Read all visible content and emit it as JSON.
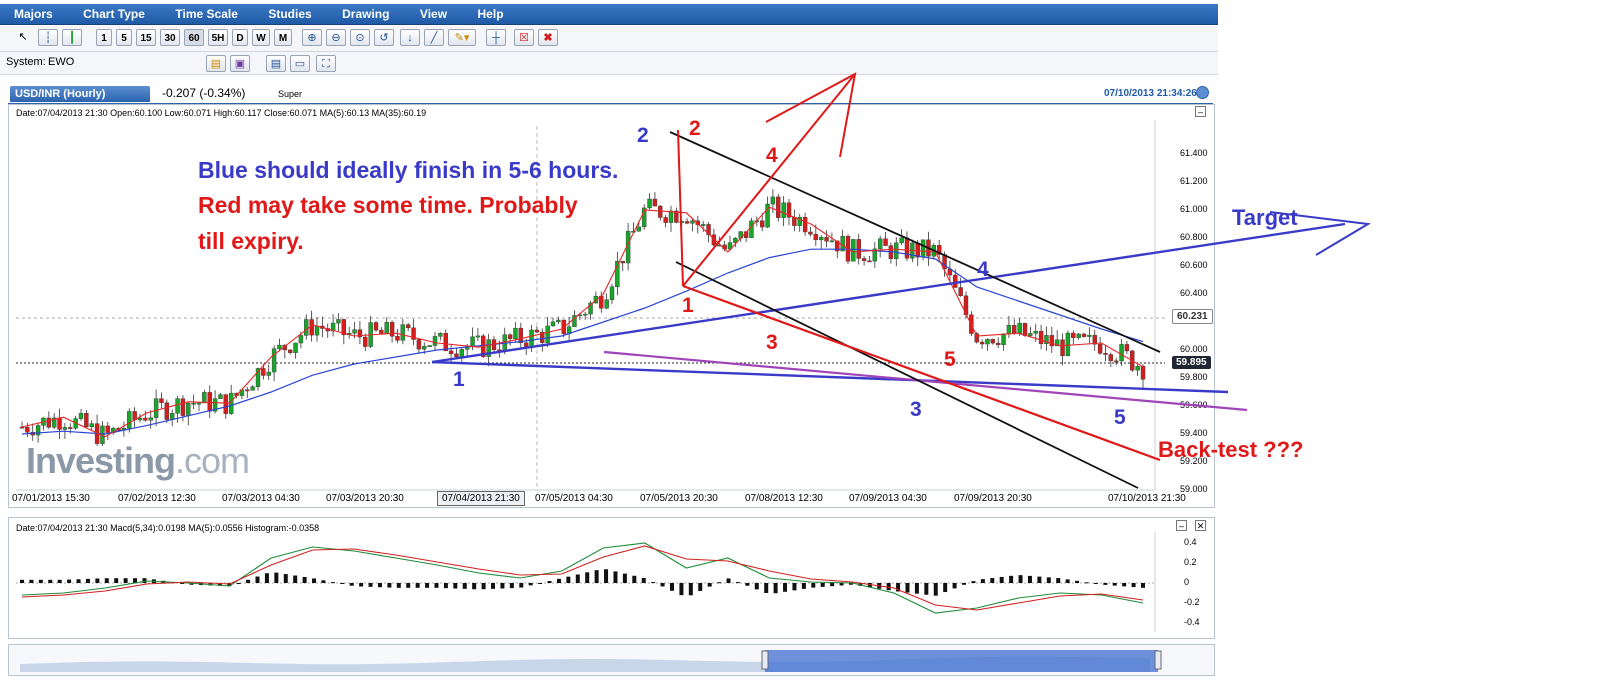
{
  "menu": [
    "Majors",
    "Chart Type",
    "Time Scale",
    "Studies",
    "Drawing",
    "View",
    "Help"
  ],
  "toolbar": {
    "intervals": [
      "1",
      "5",
      "15",
      "30",
      "60",
      "5H",
      "D",
      "W",
      "M"
    ]
  },
  "system": {
    "label": "System:",
    "value": "EWO"
  },
  "tab": {
    "title": "USD/INR (Hourly)",
    "change": "-0.207 (-0.34%)",
    "mode": "Super"
  },
  "timestamp": "07/10/2013 21:34:26",
  "info_line": "Date:07/04/2013 21:30 Open:60.100 Low:60.071 High:60.117 Close:60.071 MA(5):60.13 MA(35):60.19",
  "macd_line": "Date:07/04/2013 21:30 Macd(5,34):0.0198 MA(5):0.0556 Histogram:-0.0358",
  "logo": {
    "bold": "Investing",
    "light": ".com"
  },
  "price_tags": {
    "last": "59.895",
    "level": "60.231"
  },
  "annotations": {
    "line1": "Blue should ideally finish in 5-6 hours.",
    "line2": "Red may take some time.  Probably",
    "line3": "till expiry.",
    "target": "Target",
    "backtest": "Back-test ???",
    "blue_waves": [
      "1",
      "2",
      "3",
      "4",
      "5"
    ],
    "red_waves": [
      "1",
      "2",
      "3",
      "4",
      "5"
    ]
  },
  "colors": {
    "candle_up": "#18a52a",
    "candle_down": "#d41e1e",
    "ma5": "#e82424",
    "ma35": "#2b45d8",
    "wave_blue": "#3a3ac8",
    "wave_red": "#e01818",
    "macd": "#1f8c3a",
    "macd_signal": "#d22020"
  },
  "chart_data": [
    {
      "type": "line",
      "title": "USD/INR (Hourly)",
      "x_ticks": [
        "07/01/2013 15:30",
        "07/02/2013 12:30",
        "07/03/2013 04:30",
        "07/03/2013 20:30",
        "07/04/2013 21:30",
        "07/05/2013 04:30",
        "07/05/2013 20:30",
        "07/08/2013 12:30",
        "07/09/2013 04:30",
        "07/09/2013 20:30",
        "07/10/2013 21:30"
      ],
      "y_ticks": [
        "61.400",
        "61.200",
        "61.000",
        "60.800",
        "60.600",
        "60.400",
        "60.000",
        "59.800",
        "59.600",
        "59.400",
        "59.200",
        "59.000"
      ],
      "ylim": [
        59.0,
        61.6
      ],
      "series": [
        {
          "name": "MA(5)",
          "values": [
            59.45,
            59.52,
            59.38,
            59.55,
            59.63,
            59.62,
            59.95,
            60.18,
            60.1,
            60.12,
            60.05,
            60.02,
            60.08,
            60.15,
            60.4,
            61.0,
            60.98,
            60.7,
            61.02,
            60.9,
            60.7,
            60.72,
            60.7,
            60.1,
            60.12,
            60.03,
            60.05,
            59.88
          ]
        },
        {
          "name": "MA(35)",
          "values": [
            59.4,
            59.42,
            59.4,
            59.46,
            59.53,
            59.6,
            59.7,
            59.82,
            59.9,
            59.95,
            60.0,
            60.03,
            60.06,
            60.1,
            60.2,
            60.3,
            60.42,
            60.55,
            60.66,
            60.72,
            60.72,
            60.7,
            60.65,
            60.45,
            60.35,
            60.25,
            60.15,
            60.06
          ]
        }
      ],
      "last_price": 59.895
    },
    {
      "type": "line",
      "title": "Macd(5,34)",
      "y_ticks": [
        "0.4",
        "0.2",
        "0",
        "-0.2",
        "-0.4"
      ],
      "ylim": [
        -0.45,
        0.45
      ],
      "series": [
        {
          "name": "Macd(5,34)",
          "values": [
            -0.12,
            -0.1,
            -0.05,
            0.02,
            0.0,
            -0.03,
            0.25,
            0.36,
            0.32,
            0.25,
            0.18,
            0.1,
            0.05,
            0.12,
            0.35,
            0.4,
            0.15,
            0.25,
            0.05,
            0.01,
            0.0,
            -0.1,
            -0.3,
            -0.25,
            -0.15,
            -0.1,
            -0.12,
            -0.2
          ]
        },
        {
          "name": "MA(5)",
          "values": [
            -0.14,
            -0.12,
            -0.08,
            -0.01,
            0.01,
            -0.01,
            0.18,
            0.33,
            0.34,
            0.28,
            0.21,
            0.14,
            0.08,
            0.09,
            0.26,
            0.37,
            0.24,
            0.22,
            0.12,
            0.04,
            0.01,
            -0.05,
            -0.22,
            -0.27,
            -0.2,
            -0.13,
            -0.11,
            -0.17
          ]
        }
      ]
    }
  ]
}
